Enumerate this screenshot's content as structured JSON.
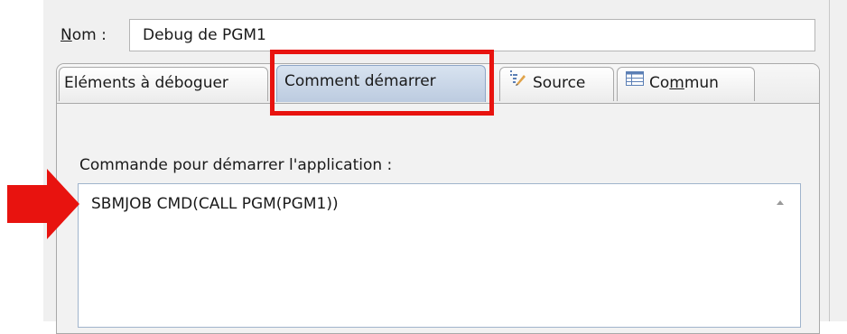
{
  "form": {
    "name_label_mnemonic": "N",
    "name_label_rest": "om :",
    "name_value": "Debug de PGM1"
  },
  "tabs": [
    {
      "label": "Eléments à déboguer"
    },
    {
      "label": "Comment démarrer",
      "selected": true
    },
    {
      "label": "Source",
      "icon": "source-icon"
    },
    {
      "label_pre": "Co",
      "label_mnemonic": "m",
      "label_post": "mun",
      "icon": "table-icon"
    }
  ],
  "command": {
    "label": "Commande pour démarrer l'application :",
    "value": "SBMJOB CMD(CALL PGM(PGM1))"
  },
  "annotations": {
    "highlight_color": "#e8130f",
    "arrow_color": "#e8130f"
  },
  "colors": {
    "selected_tab": "#c9d6e8",
    "background": "#f0f0f0"
  }
}
